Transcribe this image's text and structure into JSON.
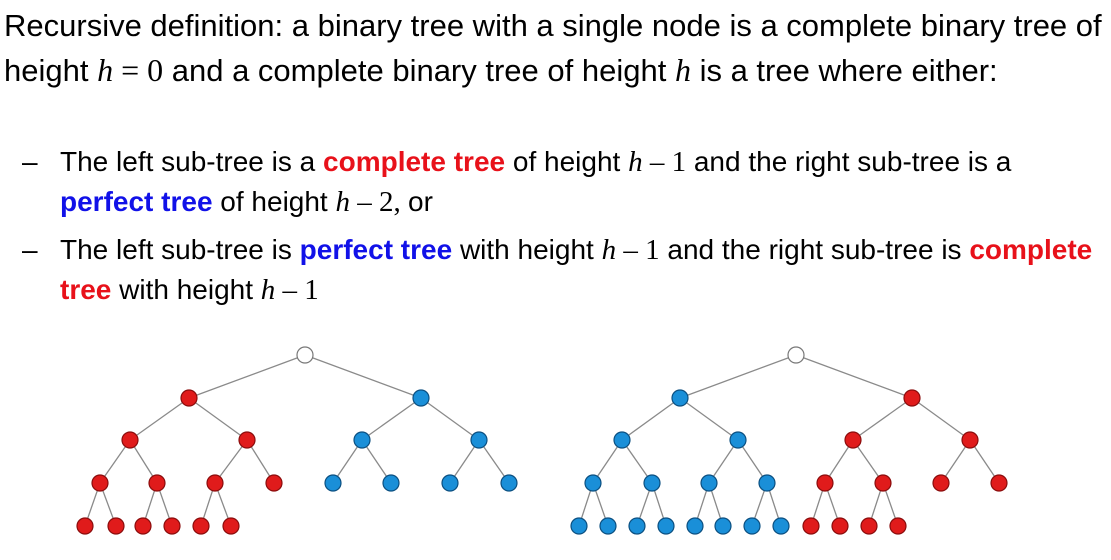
{
  "intro": {
    "part1": "Recursive definition:  a binary tree with a single node is a complete binary tree of height ",
    "var_h": "h",
    "eq_zero": " = 0",
    "part2": " and a complete binary tree of height ",
    "var_h2": "h",
    "part3": " is a tree where either:"
  },
  "bullets": [
    {
      "dash": "–",
      "t1": "The left sub-tree is a ",
      "kw1": "complete tree",
      "t2": " of height ",
      "m1_var": "h",
      "m1_rest": " – 1",
      "t3": " and the right sub-tree is a ",
      "kw2": "perfect tree",
      "t4": " of height ",
      "m2_var": "h",
      "m2_rest": " – 2, ",
      "t5": "or"
    },
    {
      "dash": "–",
      "t1": "The left sub-tree is ",
      "kw1": "perfect tree",
      "t2": " with height ",
      "m1_var": "h",
      "m1_rest": " – 1",
      "t3": " and the right sub-tree is ",
      "kw2": "complete tree",
      "t4": " with height ",
      "m2_var": "h",
      "m2_rest": " – 1",
      "t5": ""
    }
  ],
  "colors": {
    "red_node": "#e01b1b",
    "red_stroke": "#8a0c0c",
    "blue_node": "#1a8fd8",
    "blue_stroke": "#0b4f80",
    "root_fill": "#ffffff",
    "root_stroke": "#777777",
    "edge": "#8a8a8a",
    "keyword_red": "#e8111a",
    "keyword_blue": "#1111e8"
  },
  "diagrams": [
    {
      "name": "tree-left",
      "root": "white",
      "left_subtree": {
        "color": "red",
        "shape": "complete",
        "height": 3,
        "last_level_count": 6
      },
      "right_subtree": {
        "color": "blue",
        "shape": "perfect",
        "height": 2
      }
    },
    {
      "name": "tree-right",
      "root": "white",
      "left_subtree": {
        "color": "blue",
        "shape": "perfect",
        "height": 3
      },
      "right_subtree": {
        "color": "red",
        "shape": "complete",
        "height": 3,
        "last_level_count": 4
      }
    }
  ]
}
